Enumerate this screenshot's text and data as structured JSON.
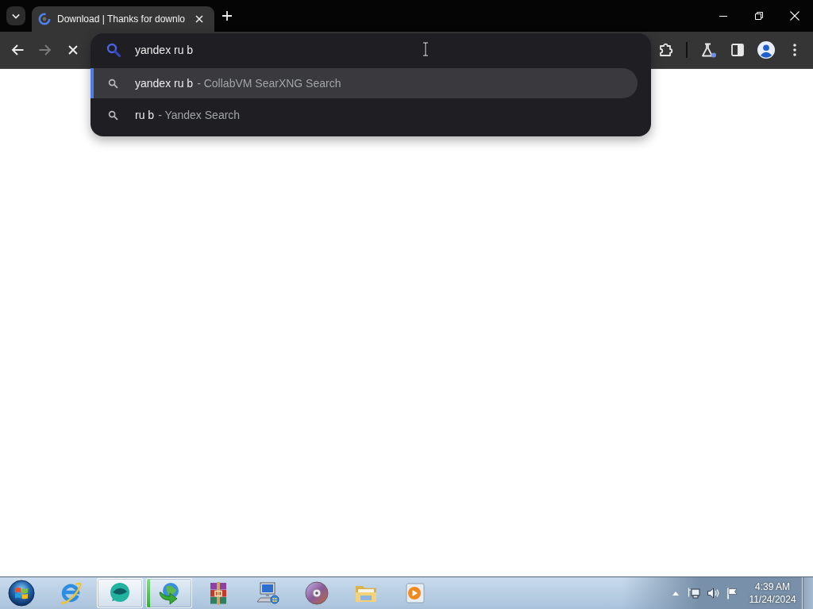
{
  "tab_strip": {
    "tabs": [
      {
        "title": "Download | Thanks for downlo",
        "selected": true
      }
    ]
  },
  "toolbar": {
    "nav_buttons": [
      {
        "kind": "back",
        "disabled": false
      },
      {
        "kind": "forward",
        "disabled": true
      },
      {
        "kind": "stop",
        "disabled": false
      }
    ]
  },
  "omnibox": {
    "value": "yandex ru b",
    "suggestions": [
      {
        "match": "yandex ru b",
        "source": "- CollabVM SearXNG Search",
        "selected": true
      },
      {
        "match": "ru b",
        "source": "- Yandex Search",
        "selected": false
      }
    ]
  },
  "taskbar": {
    "items": [
      {
        "kind": "ie",
        "running": false,
        "selected": false
      },
      {
        "kind": "bubble",
        "running": true,
        "selected": true
      },
      {
        "kind": "idm",
        "running": true,
        "selected": false,
        "level": 0.08
      },
      {
        "kind": "winrar",
        "running": false,
        "selected": false
      },
      {
        "kind": "computer",
        "running": false,
        "selected": false
      },
      {
        "kind": "disc",
        "running": false,
        "selected": false
      },
      {
        "kind": "folder",
        "running": false,
        "selected": false
      },
      {
        "kind": "media",
        "running": false,
        "selected": false
      }
    ],
    "clock": {
      "time": "4:39 AM",
      "date": "11/24/2024"
    }
  }
}
